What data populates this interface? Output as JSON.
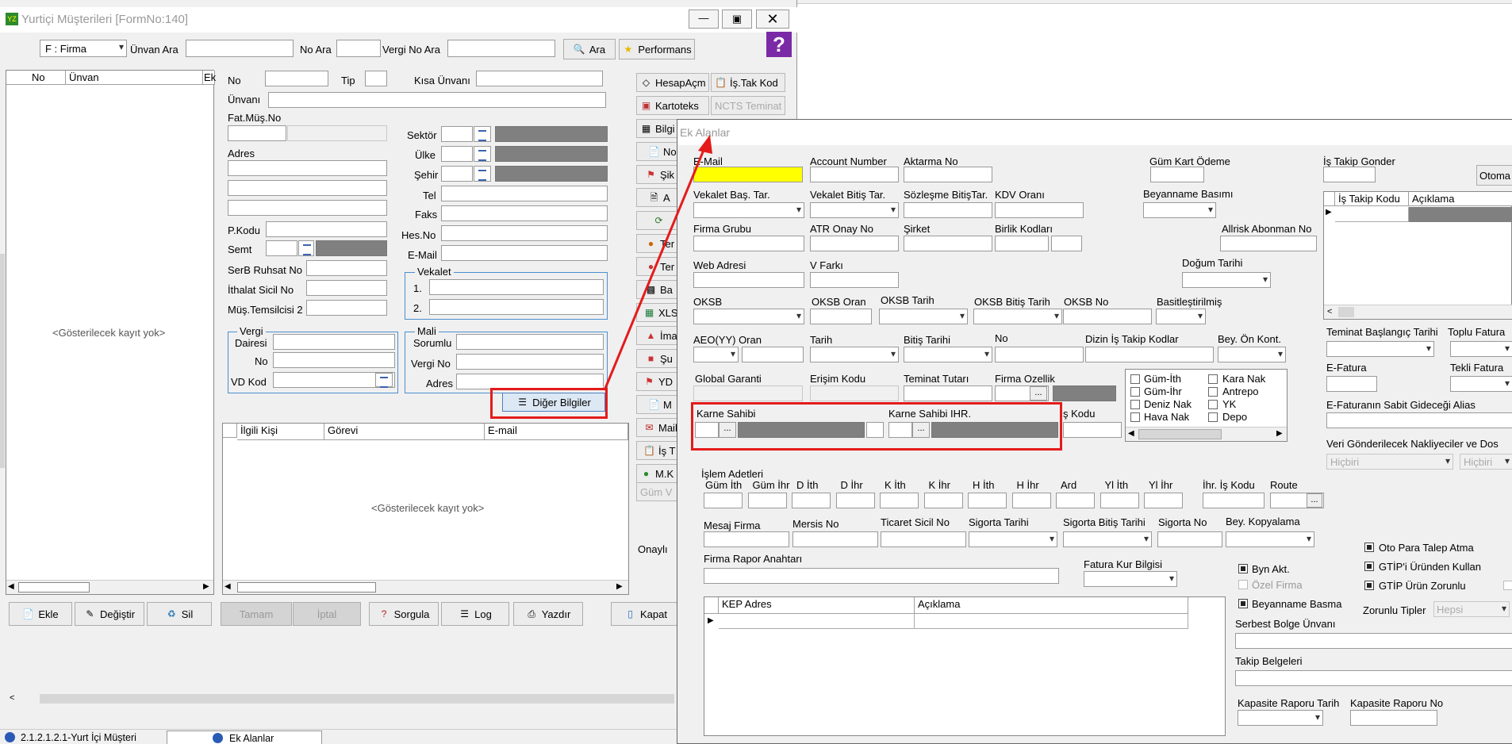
{
  "main_window": {
    "title": "Yurtiçi Müşterileri [FormNo:140]",
    "toolbar": {
      "firma_select": "F : Firma",
      "unvan_ara": "Ünvan Ara",
      "no_ara": "No Ara",
      "vergi_no_ara": "Vergi No Ara",
      "ara": "Ara",
      "performans": "Performans"
    },
    "list_headers": {
      "no": "No",
      "unvan": "Ünvan",
      "ek": "Ek"
    },
    "empty_text": "<Gösterilecek kayıt yok>",
    "fields": {
      "no": "No",
      "tip": "Tip",
      "kisa_unvani": "Kısa Ünvanı",
      "unvani": "Ünvanı",
      "fat_mus_no": "Fat.Müş.No",
      "adres": "Adres",
      "sektor": "Sektör",
      "ulke": "Ülke",
      "sehir": "Şehir",
      "tel": "Tel",
      "faks": "Faks",
      "hes_no": "Hes.No",
      "email": "E-Mail",
      "pkodu": "P.Kodu",
      "semt": "Semt",
      "serb_ruhsat": "SerB Ruhsat No",
      "ithalat_sicil": "İthalat Sicil No",
      "mus_temsilcisi": "Müş.Temsilcisi 2",
      "vekalet": "Vekalet",
      "vek1": "1.",
      "vek2": "2.",
      "vergi": "Vergi",
      "dairesi": "Dairesi",
      "vno": "No",
      "vd_kod": "VD Kod",
      "mali": "Mali",
      "sorumlu": "Sorumlu",
      "mali_vergi_no": "Vergi No",
      "mali_adres": "Adres"
    },
    "diger_bilgiler": "Diğer Bilgiler",
    "contact_headers": {
      "ilgili": "İlgili Kişi",
      "gorevi": "Görevi",
      "email": "E-mail"
    },
    "contact_empty": "<Gösterilecek kayıt yok>",
    "side_buttons": [
      "HesapAçm",
      "İş.Tak Kod",
      "Kartoteks",
      "NCTS Teminat",
      "Bilgi",
      "No",
      "Şik",
      "A",
      "",
      "Ter",
      "Ter",
      "Ba",
      "XLS",
      "İma",
      "Şu",
      "YD",
      "M",
      "Mail",
      "İş T",
      "M.K",
      "Güm V"
    ],
    "onayli": "Onaylı",
    "bottom_buttons": {
      "ekle": "Ekle",
      "degistir": "Değiştir",
      "sil": "Sil",
      "tamam": "Tamam",
      "iptal": "İptal",
      "sorgula": "Sorgula",
      "log": "Log",
      "yazdir": "Yazdır",
      "kapat": "Kapat"
    }
  },
  "taskbar": {
    "item1": "2.1.2.1.2.1-Yurt İçi Müşteri",
    "item2": "Ek Alanlar"
  },
  "ek_alanlar": {
    "title": "Ek Alanlar",
    "labels": {
      "email": "E-Mail",
      "account_number": "Account Number",
      "aktarma_no": "Aktarma No",
      "gum_kart_odeme": "Güm Kart Ödeme",
      "is_takip_gonder": "İş Takip Gonder",
      "otomatik": "Otoma",
      "vekalet_bas": "Vekalet Baş. Tar.",
      "vekalet_bitis": "Vekalet Bitiş Tar.",
      "sozlesme_bitis": "Sözleşme BitişTar.",
      "kdv_orani": "KDV Oranı",
      "beyanname_basimi": "Beyanname Basımı",
      "firma_grubu": "Firma Grubu",
      "atr_onay": "ATR Onay No",
      "sirket": "Şirket",
      "birlik_kodlari": "Birlik Kodları",
      "allrisk": "Allrisk Abonman No",
      "web_adresi": "Web Adresi",
      "v_farki": "V Farkı",
      "dogum_tarihi": "Doğum Tarihi",
      "oksb": "OKSB",
      "oksb_oran": "OKSB Oran",
      "oksb_tarih": "OKSB Tarih",
      "oksb_bitis": "OKSB Bitiş Tarih",
      "oksb_no": "OKSB No",
      "basitlestirilmis": "Basitleştirilmiş",
      "aeo_oran": "AEO(YY) Oran",
      "tarih": "Tarih",
      "bitis_tarihi": "Bitiş Tarihi",
      "no": "No",
      "dizin_is_takip": "Dizin İş Takip Kodlar",
      "bey_on_kont": "Bey. Ön Kont.",
      "global_garanti": "Global Garanti",
      "erisim_kodu": "Erişim Kodu",
      "teminat_tutari": "Teminat Tutarı",
      "firma_ozellik": "Firma Ozellik",
      "karne_sahibi": "Karne Sahibi",
      "karne_sahibi_ihr": "Karne Sahibi IHR.",
      "is_kodu": "ş Kodu",
      "islem_adetleri": "İşlem Adetleri",
      "ihr_is_kodu": "İhr. İş Kodu",
      "route": "Route",
      "mesaj_firma": "Mesaj Firma",
      "mersis_no": "Mersis No",
      "ticaret_sicil": "Ticaret Sicil No",
      "sigorta_tarihi": "Sigorta Tarihi",
      "sigorta_bitis": "Sigorta Bitiş Tarihi",
      "sigorta_no": "Sigorta No",
      "bey_kopyalama": "Bey. Kopyalama",
      "firma_rapor": "Firma Rapor Anahtarı",
      "fatura_kur": "Fatura Kur Bilgisi",
      "teminat_baslangic": "Teminat Başlangıç Tarihi",
      "toplu_fatura": "Toplu Fatura",
      "e_fatura": "E-Fatura",
      "tekli_fatura": "Tekli Fatura",
      "e_fatura_alias": "E-Faturanın Sabit Gideceği Alias",
      "veri_gonderilecek": "Veri Gönderilecek Nakliyeciler ve Dos",
      "hicbiri": "Hiçbiri",
      "hicbiri2": "Hiçbiri",
      "serbest_bolge": "Serbest Bolge Ünvanı",
      "takip_belgeleri": "Takip Belgeleri",
      "kapasite_tarih": "Kapasite Raporu Tarih",
      "kapasite_no": "Kapasite Raporu No",
      "zorunlu_tipler": "Zorunlu Tipler",
      "hepsi": "Hepsi"
    },
    "is_takip_headers": {
      "kod": "İş Takip Kodu",
      "aciklama": "Açıklama"
    },
    "islem_cols": [
      "Güm İth",
      "Güm İhr",
      "D İth",
      "D İhr",
      "K İth",
      "K İhr",
      "H İth",
      "H İhr",
      "Ard",
      "Yl İth",
      "Yl İhr"
    ],
    "checklist": [
      "Güm-İth",
      "Güm-İhr",
      "Deniz Nak",
      "Hava Nak",
      "Kara Nak",
      "Antrepo",
      "YK",
      "Depo"
    ],
    "checks": {
      "byn_akt": "Byn Akt.",
      "ozel_firma": "Özel Firma",
      "beyanname_basma": "Beyanname Basma",
      "oto_para": "Oto Para Talep Atma",
      "gtip_urunden": "GTİP'i Üründen Kullan",
      "gtip_zorunlu": "GTİP Ürün Zorunlu"
    },
    "kep_headers": {
      "adres": "KEP Adres",
      "aciklama": "Açıklama"
    }
  },
  "colors": {
    "highlight": "#e41b1b",
    "email_field": "#ffff00",
    "selection": "#808080"
  }
}
